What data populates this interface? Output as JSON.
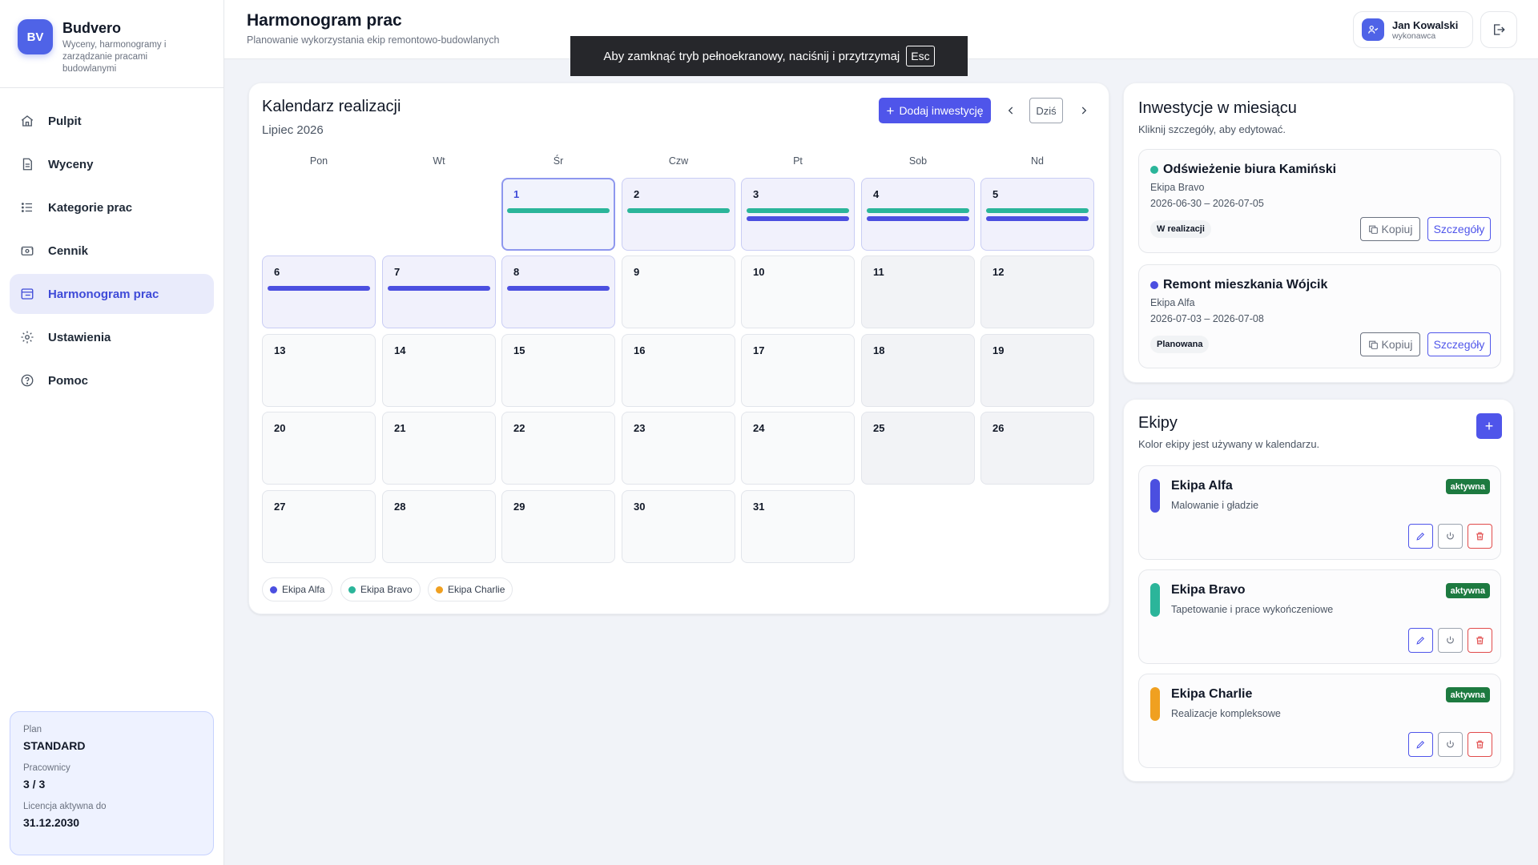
{
  "brand": {
    "logo": "BV",
    "name": "Budvero",
    "subtitle": "Wyceny, harmonogramy i zarządzanie pracami budowlanymi"
  },
  "nav": [
    {
      "label": "Pulpit",
      "icon": "home-icon"
    },
    {
      "label": "Wyceny",
      "icon": "document-icon"
    },
    {
      "label": "Kategorie prac",
      "icon": "list-icon"
    },
    {
      "label": "Cennik",
      "icon": "money-icon"
    },
    {
      "label": "Harmonogram prac",
      "icon": "calendar-board-icon",
      "active": true
    },
    {
      "label": "Ustawienia",
      "icon": "gear-icon"
    },
    {
      "label": "Pomoc",
      "icon": "help-icon"
    }
  ],
  "plan": {
    "plan_label": "Plan",
    "plan_value": "STANDARD",
    "workers_label": "Pracownicy",
    "workers_value": "3 / 3",
    "license_label": "Licencja aktywna do",
    "license_value": "31.12.2030"
  },
  "header": {
    "title": "Harmonogram prac",
    "subtitle": "Planowanie wykorzystania ekip remontowo-budowlanych",
    "user_name": "Jan Kowalski",
    "user_role": "wykonawca"
  },
  "fullscreen_notice": {
    "text": "Aby zamknąć tryb pełnoekranowy, naciśnij i przytrzymaj",
    "key": "Esc"
  },
  "calendar": {
    "title": "Kalendarz realizacji",
    "month": "Lipiec 2026",
    "add_button": "Dodaj inwestycję",
    "today_button": "Dziś",
    "weekdays": [
      "Pon",
      "Wt",
      "Śr",
      "Czw",
      "Pt",
      "Sob",
      "Nd"
    ],
    "first_weekday_index": 2,
    "days_in_month": 31,
    "today": 1,
    "assignments": {
      "1": [
        "bravo"
      ],
      "2": [
        "bravo"
      ],
      "3": [
        "bravo",
        "alfa"
      ],
      "4": [
        "bravo",
        "alfa"
      ],
      "5": [
        "bravo",
        "alfa"
      ],
      "6": [
        "alfa"
      ],
      "7": [
        "alfa"
      ],
      "8": [
        "alfa"
      ]
    },
    "legend": [
      {
        "label": "Ekipa Alfa",
        "color": "#4b4fe0"
      },
      {
        "label": "Ekipa Bravo",
        "color": "#2bb59a"
      },
      {
        "label": "Ekipa Charlie",
        "color": "#f0a020"
      }
    ]
  },
  "investments": {
    "title": "Inwestycje w miesiącu",
    "subtitle": "Kliknij szczegóły, aby edytować.",
    "copy_label": "Kopiuj",
    "details_label": "Szczegóły",
    "items": [
      {
        "name": "Odświeżenie biura Kamiński",
        "team": "Ekipa Bravo",
        "dates": "2026-06-30 – 2026-07-05",
        "status": "W realizacji",
        "color": "#2bb59a"
      },
      {
        "name": "Remont mieszkania Wójcik",
        "team": "Ekipa Alfa",
        "dates": "2026-07-03 – 2026-07-08",
        "status": "Planowana",
        "color": "#4b4fe0"
      }
    ]
  },
  "teams": {
    "title": "Ekipy",
    "subtitle": "Kolor ekipy jest używany w kalendarzu.",
    "items": [
      {
        "name": "Ekipa Alfa",
        "description": "Malowanie i gładzie",
        "status": "aktywna",
        "color": "#4b4fe0"
      },
      {
        "name": "Ekipa Bravo",
        "description": "Tapetowanie i prace wykończeniowe",
        "status": "aktywna",
        "color": "#2bb59a"
      },
      {
        "name": "Ekipa Charlie",
        "description": "Realizacje kompleksowe",
        "status": "aktywna",
        "color": "#f0a020"
      }
    ]
  }
}
